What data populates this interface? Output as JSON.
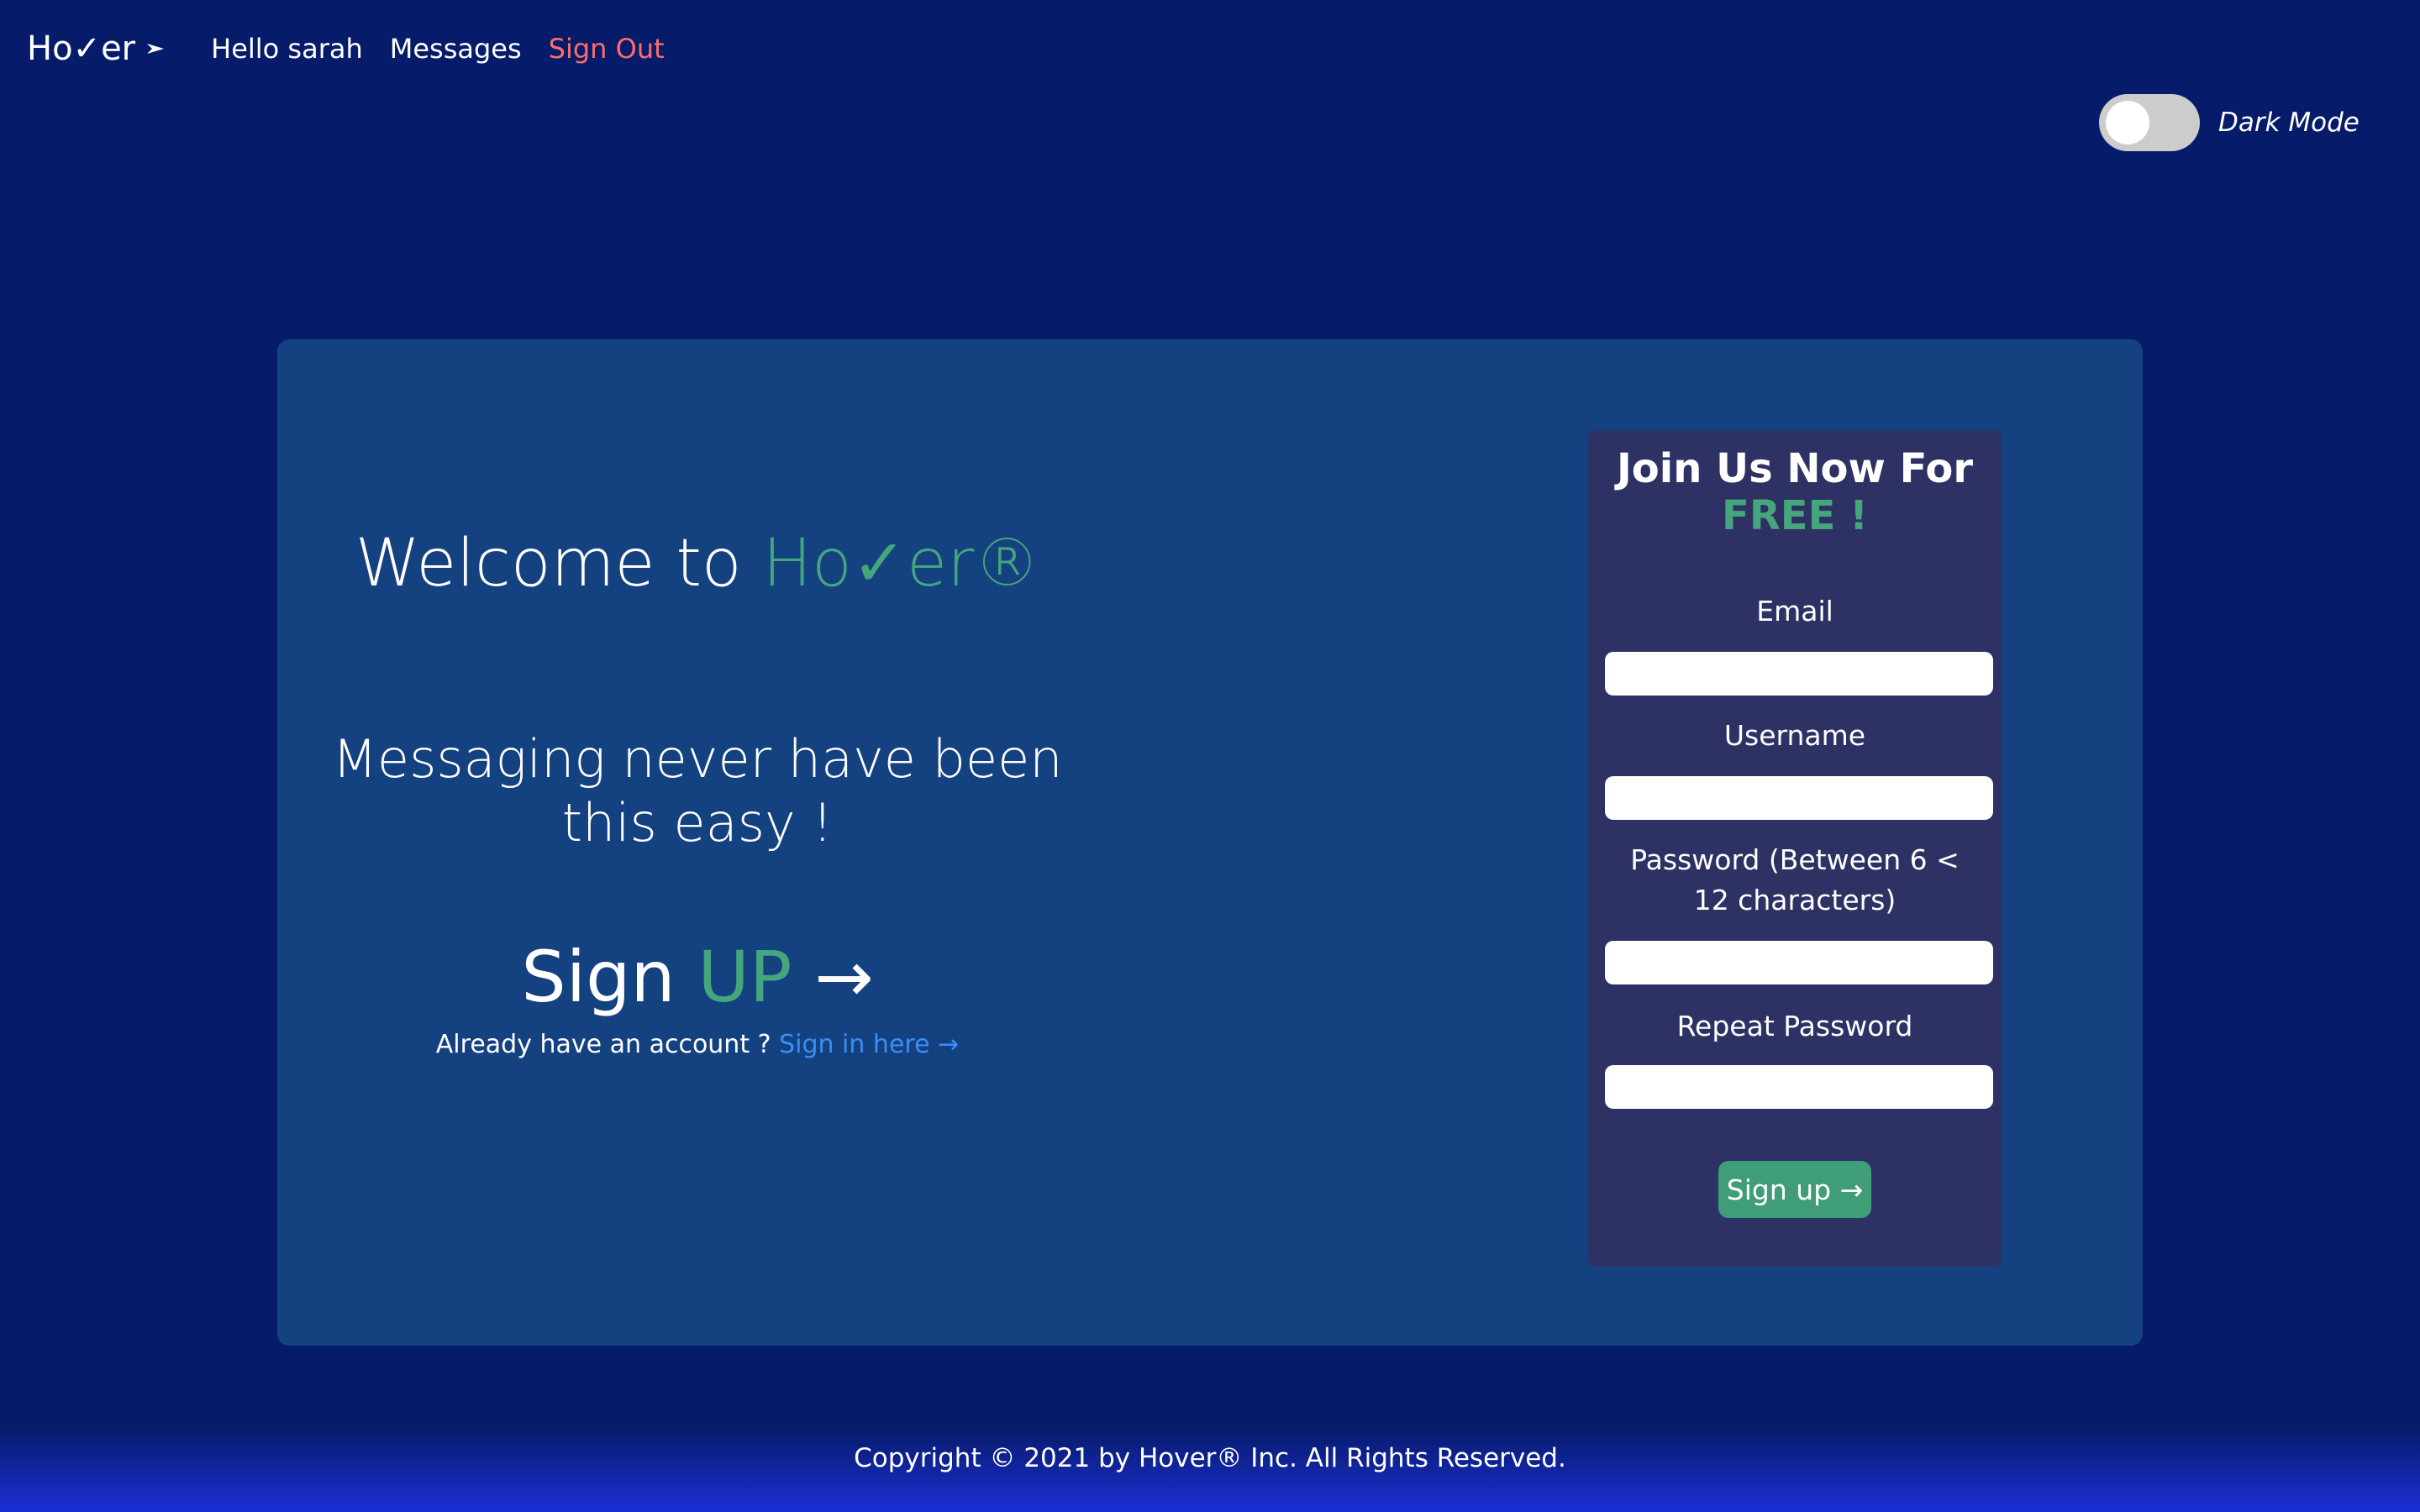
{
  "nav": {
    "brand": "Ho✓er",
    "brand_icon": "arrow-right-icon",
    "links": [
      {
        "label": "Hello sarah"
      },
      {
        "label": "Messages"
      },
      {
        "label": "Sign Out"
      }
    ]
  },
  "dark_mode": {
    "label": "Dark Mode",
    "enabled": false
  },
  "hero": {
    "title_prefix": "Welcome to ",
    "title_brand": "Ho✓er®",
    "subtitle": "Messaging never have been this easy !",
    "cta_prefix": "Sign ",
    "cta_highlight": "UP",
    "cta_arrow": "→",
    "signin_prompt": "Already have an account ? ",
    "signin_link": "Sign in here →"
  },
  "signup_form": {
    "title_line1": "Join Us Now For",
    "title_line2": "FREE !",
    "fields": {
      "email": {
        "label": "Email",
        "value": "",
        "placeholder": ""
      },
      "username": {
        "label": "Username",
        "value": "",
        "placeholder": ""
      },
      "password": {
        "label": "Password (Between 6 < 12 characters)",
        "value": "",
        "placeholder": ""
      },
      "repeat_password": {
        "label": "Repeat Password",
        "value": "",
        "placeholder": ""
      }
    },
    "submit_label": "Sign up →"
  },
  "footer": {
    "copyright": "Copyright © 2021 by Hover® Inc. All Rights Reserved."
  },
  "colors": {
    "background": "#061b6a",
    "card": "#14417f",
    "panel": "#2e3163",
    "accent_green": "#45a57c",
    "link_blue": "#3b8ef5",
    "signout_red": "#ff6b6b"
  }
}
